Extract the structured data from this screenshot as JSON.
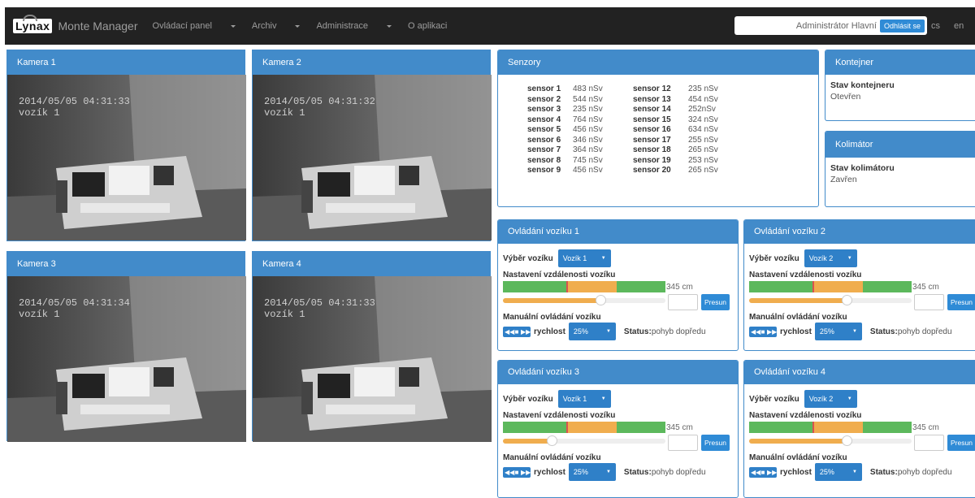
{
  "nav": {
    "logo": "Lynax",
    "brand": "Monte Manager",
    "menu": [
      "Ovládací panel",
      "Archiv",
      "Administrace",
      "O aplikaci"
    ],
    "user": "Administrátor Hlavní",
    "logout": "Odhlásit se",
    "lang_cs": "cs",
    "lang_en": "en"
  },
  "cameras": [
    {
      "title": "Kamera 1",
      "date": "2014/05/05 04:31:33",
      "cart": "vozík 1"
    },
    {
      "title": "Kamera 2",
      "date": "2014/05/05 04:31:32",
      "cart": "vozík 1"
    },
    {
      "title": "Kamera 3",
      "date": "2014/05/05 04:31:34",
      "cart": "vozík 1"
    },
    {
      "title": "Kamera 4",
      "date": "2014/05/05 04:31:33",
      "cart": "vozík 1"
    }
  ],
  "sensors": {
    "title": "Senzory",
    "col1": [
      {
        "name": "sensor 1",
        "value": "483 nSv"
      },
      {
        "name": "sensor 2",
        "value": "544 nSv"
      },
      {
        "name": "sensor 3",
        "value": "235 nSv"
      },
      {
        "name": "sensor 4",
        "value": "764 nSv"
      },
      {
        "name": "sensor 5",
        "value": "456 nSv"
      },
      {
        "name": "sensor 6",
        "value": "346 nSv"
      },
      {
        "name": "sensor 7",
        "value": "364 nSv"
      },
      {
        "name": "sensor 8",
        "value": "745 nSv"
      },
      {
        "name": "sensor 9",
        "value": "456 nSv"
      }
    ],
    "col2": [
      {
        "name": "sensor 12",
        "value": "235 nSv"
      },
      {
        "name": "sensor 13",
        "value": "454 nSv"
      },
      {
        "name": "sensor 14",
        "value": "252nSv"
      },
      {
        "name": "sensor 15",
        "value": "324 nSv"
      },
      {
        "name": "sensor 16",
        "value": "634 nSv"
      },
      {
        "name": "sensor 17",
        "value": "255 nSv"
      },
      {
        "name": "sensor 18",
        "value": "265 nSv"
      },
      {
        "name": "sensor 19",
        "value": "253 nSv"
      },
      {
        "name": "sensor 20",
        "value": "265 nSv"
      }
    ]
  },
  "container": {
    "title": "Kontejner",
    "label": "Stav kontejneru",
    "value": "Otevřen"
  },
  "collimator": {
    "title": "Kolimátor",
    "label": "Stav kolimátoru",
    "value": "Zavřen"
  },
  "carts": [
    {
      "title": "Ovládání vozíku 1",
      "select_label": "Výběr vozíku",
      "selected": "Vozík 1",
      "distance_label": "Nastavení vzdálenosti vozíku",
      "distance": "345 cm",
      "move": "Presun",
      "manual_label": "Manuální ovládání vozíku",
      "speed_label": "rychlost",
      "speed": "25%",
      "status_label": "Status:",
      "status": "pohyb dopředu",
      "slider_fraction": 0.6
    },
    {
      "title": "Ovládání vozíku 2",
      "select_label": "Výběr vozíku",
      "selected": "Vozík 2",
      "distance_label": "Nastavení vzdálenosti vozíku",
      "distance": "345 cm",
      "move": "Presun",
      "manual_label": "Manuální ovládání vozíku",
      "speed_label": "rychlost",
      "speed": "25%",
      "status_label": "Status:",
      "status": "pohyb dopředu",
      "slider_fraction": 0.6
    },
    {
      "title": "Ovládání vozíku 3",
      "select_label": "Výběr vozíku",
      "selected": "Vozík 1",
      "distance_label": "Nastavení vzdálenosti vozíku",
      "distance": "345 cm",
      "move": "Presun",
      "manual_label": "Manuální ovládání vozíku",
      "speed_label": "rychlost",
      "speed": "25%",
      "status_label": "Status:",
      "status": "pohyb dopředu",
      "slider_fraction": 0.3
    },
    {
      "title": "Ovládání vozíku 4",
      "select_label": "Výběr vozíku",
      "selected": "Vozík 2",
      "distance_label": "Nastavení vzdálenosti vozíku",
      "distance": "345 cm",
      "move": "Presun",
      "manual_label": "Manuální ovládání vozíku",
      "speed_label": "rychlost",
      "speed": "25%",
      "status_label": "Status:",
      "status": "pohyb dopředu",
      "slider_fraction": 0.6
    }
  ],
  "colors": {
    "primary": "#428bca",
    "navbar": "#222222",
    "green": "#5cb85c",
    "orange": "#f0ad4e",
    "red": "#d9534f"
  }
}
